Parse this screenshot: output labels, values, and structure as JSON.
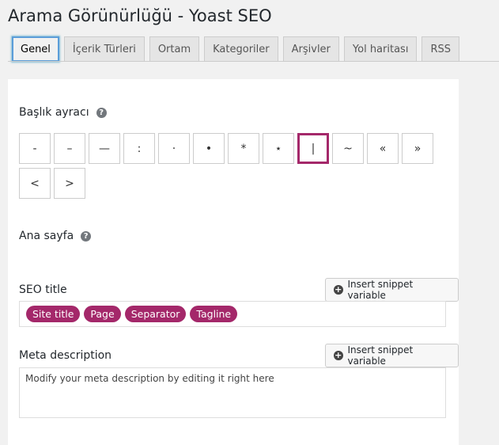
{
  "page": {
    "title": "Arama Görünürlüğü - Yoast SEO"
  },
  "tabs": [
    {
      "label": "Genel",
      "active": true
    },
    {
      "label": "İçerik Türleri"
    },
    {
      "label": "Ortam"
    },
    {
      "label": "Kategoriler"
    },
    {
      "label": "Arşivler"
    },
    {
      "label": "Yol haritası"
    },
    {
      "label": "RSS"
    }
  ],
  "title_separator": {
    "label": "Başlık ayracı",
    "help_icon": "question-circle-icon",
    "options": [
      "-",
      "–",
      "—",
      ":",
      "·",
      "•",
      "*",
      "⋆",
      "|",
      "~",
      "«",
      "»",
      "<",
      ">"
    ],
    "selected": "|",
    "selected_color": "#a4286a"
  },
  "homepage": {
    "label": "Ana sayfa",
    "help_icon": "question-circle-icon"
  },
  "seo_title": {
    "label": "SEO title",
    "snippet_button": "Insert snippet variable",
    "variables": [
      "Site title",
      "Page",
      "Separator",
      "Tagline"
    ]
  },
  "meta_description": {
    "label": "Meta description",
    "snippet_button": "Insert snippet variable",
    "placeholder": "Modify your meta description by editing it right here"
  },
  "colors": {
    "accent": "#a4286a",
    "background": "#f1f1f1",
    "panel": "#ffffff"
  }
}
